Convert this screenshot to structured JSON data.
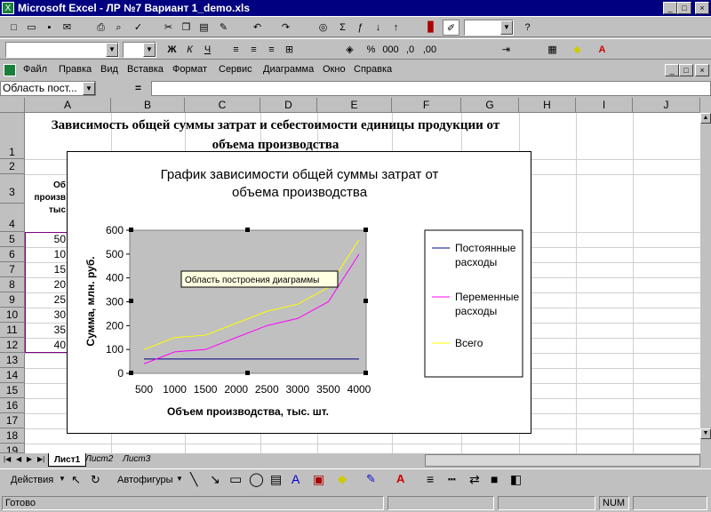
{
  "window": {
    "title": "Microsoft Excel - ЛР №7  Вариант 1_demo.xls",
    "app_icon": "X",
    "controls": [
      "_",
      "□",
      "×"
    ],
    "doc_controls": [
      "_",
      "□",
      "×"
    ]
  },
  "menu": [
    "Файл",
    "Правка",
    "Вид",
    "Вставка",
    "Формат",
    "Сервис",
    "Диаграмма",
    "Окно",
    "Справка"
  ],
  "formula": {
    "name_box": "Область пост...",
    "eq": "="
  },
  "columns": [
    "A",
    "B",
    "C",
    "D",
    "E",
    "F",
    "G",
    "H",
    "I",
    "J"
  ],
  "rows": [
    "1",
    "2",
    "3",
    "4",
    "5",
    "6",
    "7",
    "8",
    "9",
    "10",
    "11",
    "12",
    "13",
    "14",
    "15",
    "16",
    "17",
    "18",
    "19"
  ],
  "sheet": {
    "title": "Зависимость общей суммы затрат и себестоимости единицы продукции от объема производства",
    "header_partial": [
      "Об",
      "произв",
      "тыс"
    ],
    "col_a_values": [
      "50",
      "10",
      "15",
      "20",
      "25",
      "30",
      "35",
      "40"
    ]
  },
  "chart_data": {
    "type": "line",
    "title": "График зависимости общей суммы затрат от объема производства",
    "xlabel": "Объем производства, тыс. шт.",
    "ylabel": "Сумма, млн. руб.",
    "categories": [
      "500",
      "1000",
      "1500",
      "2000",
      "2500",
      "3000",
      "3500",
      "4000"
    ],
    "ylim": [
      0,
      600
    ],
    "yticks": [
      "0",
      "100",
      "200",
      "300",
      "400",
      "500",
      "600"
    ],
    "series": [
      {
        "name": "Постоянные расходы",
        "color": "#000080",
        "values": [
          60,
          60,
          60,
          60,
          60,
          60,
          60,
          60
        ]
      },
      {
        "name": "Переменные расходы",
        "color": "#ff00ff",
        "values": [
          40,
          90,
          100,
          150,
          200,
          230,
          300,
          500
        ]
      },
      {
        "name": "Всего",
        "color": "#ffff00",
        "values": [
          100,
          150,
          160,
          210,
          260,
          290,
          360,
          560
        ]
      }
    ],
    "plot_bg": "#c0c0c0",
    "legend_position": "right",
    "tooltip": "Область построения диаграммы"
  },
  "tabs": [
    "Лист1",
    "Лист2",
    "Лист3"
  ],
  "drawing": {
    "actions": "Действия",
    "autoshapes": "Автофигуры"
  },
  "status": {
    "ready": "Готово",
    "num": "NUM"
  }
}
